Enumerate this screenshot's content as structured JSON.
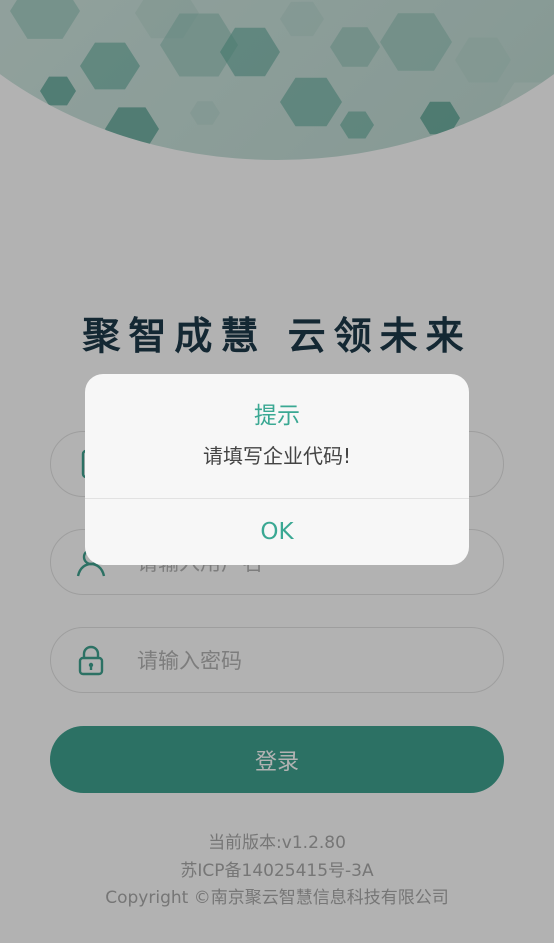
{
  "header": {
    "slogan": "聚智成慧   云领未来",
    "banner_colors": [
      "#2e8a78",
      "#5aa897",
      "#8cc1b4",
      "#b7d7ce",
      "#d5e8e2"
    ]
  },
  "form": {
    "company_placeholder": "",
    "username_placeholder": "请输入用户名",
    "password_placeholder": "请输入密码",
    "login_label": "登录",
    "icons": {
      "company": "phone-icon",
      "username": "user-icon",
      "password": "lock-icon"
    }
  },
  "footer": {
    "version": "当前版本:v1.2.80",
    "icp": "苏ICP备14025415号-3A",
    "copyright": "Copyright ©南京聚云智慧信息科技有限公司"
  },
  "dialog": {
    "title": "提示",
    "message": "请填写企业代码!",
    "ok_label": "OK"
  },
  "colors": {
    "accent": "#3fa390",
    "dialog_accent": "#3aa893",
    "slogan": "#1e3a4a"
  }
}
